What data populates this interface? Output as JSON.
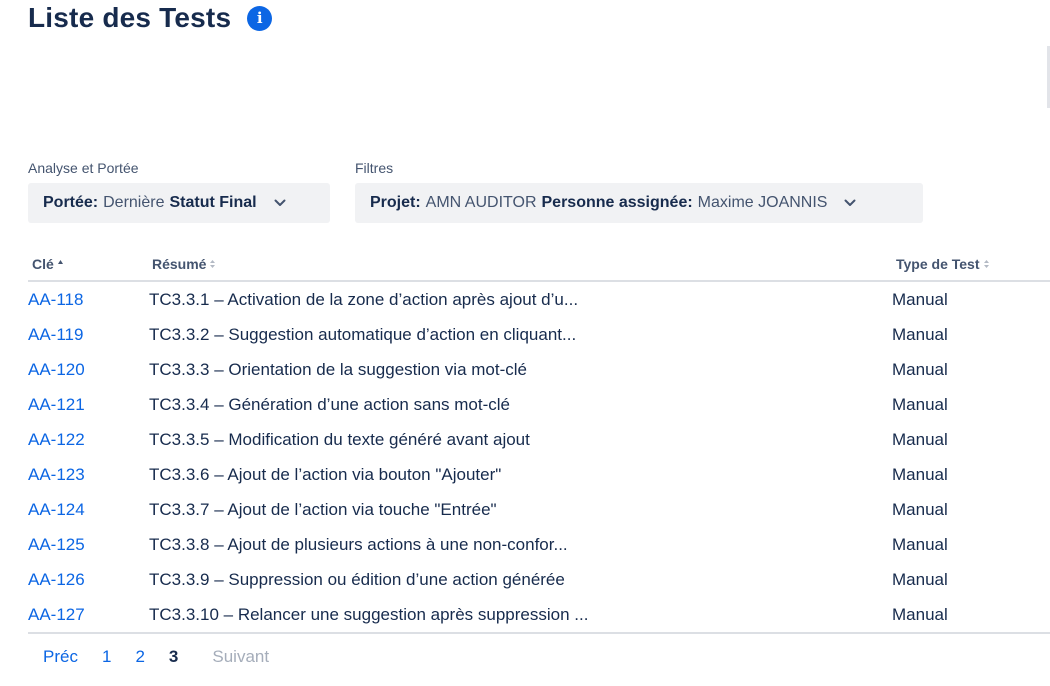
{
  "page": {
    "title": "Liste des Tests",
    "info_icon": "info-icon"
  },
  "filters": {
    "analyse": {
      "label": "Analyse et Portée",
      "button": {
        "key1": "Portée:",
        "val1": "Dernière",
        "key2": "Statut Final"
      }
    },
    "filtres": {
      "label": "Filtres",
      "button": {
        "key1": "Projet:",
        "val1": "AMN AUDITOR",
        "key2": "Personne assignée:",
        "val2": "Maxime JOANNIS"
      }
    }
  },
  "table": {
    "columns": {
      "key": "Clé",
      "summary": "Résumé",
      "type": "Type de Test"
    },
    "rows": [
      {
        "key": "AA-118",
        "summary": "TC3.3.1 – Activation de la zone d’action après ajout d’u...",
        "type": "Manual"
      },
      {
        "key": "AA-119",
        "summary": "TC3.3.2 – Suggestion automatique d’action en cliquant...",
        "type": "Manual"
      },
      {
        "key": "AA-120",
        "summary": "TC3.3.3 – Orientation de la suggestion via mot-clé",
        "type": "Manual"
      },
      {
        "key": "AA-121",
        "summary": "TC3.3.4 – Génération d’une action sans mot-clé",
        "type": "Manual"
      },
      {
        "key": "AA-122",
        "summary": "TC3.3.5 – Modification du texte généré avant ajout",
        "type": "Manual"
      },
      {
        "key": "AA-123",
        "summary": "TC3.3.6 – Ajout de l’action via bouton \"Ajouter\"",
        "type": "Manual"
      },
      {
        "key": "AA-124",
        "summary": "TC3.3.7 – Ajout de l’action via touche \"Entrée\"",
        "type": "Manual"
      },
      {
        "key": "AA-125",
        "summary": "TC3.3.8 – Ajout de plusieurs actions à une non-confor...",
        "type": "Manual"
      },
      {
        "key": "AA-126",
        "summary": "TC3.3.9 – Suppression ou édition d’une action générée",
        "type": "Manual"
      },
      {
        "key": "AA-127",
        "summary": "TC3.3.10 – Relancer une suggestion après suppression ...",
        "type": "Manual"
      }
    ]
  },
  "pagination": {
    "prev": "Préc",
    "pages": [
      "1",
      "2",
      "3"
    ],
    "current": "3",
    "next": "Suivant"
  },
  "colors": {
    "link": "#0c66e4",
    "text": "#172b4d",
    "subtle": "#44546f",
    "button_bg": "#f1f2f4",
    "disabled": "#a5adba"
  }
}
